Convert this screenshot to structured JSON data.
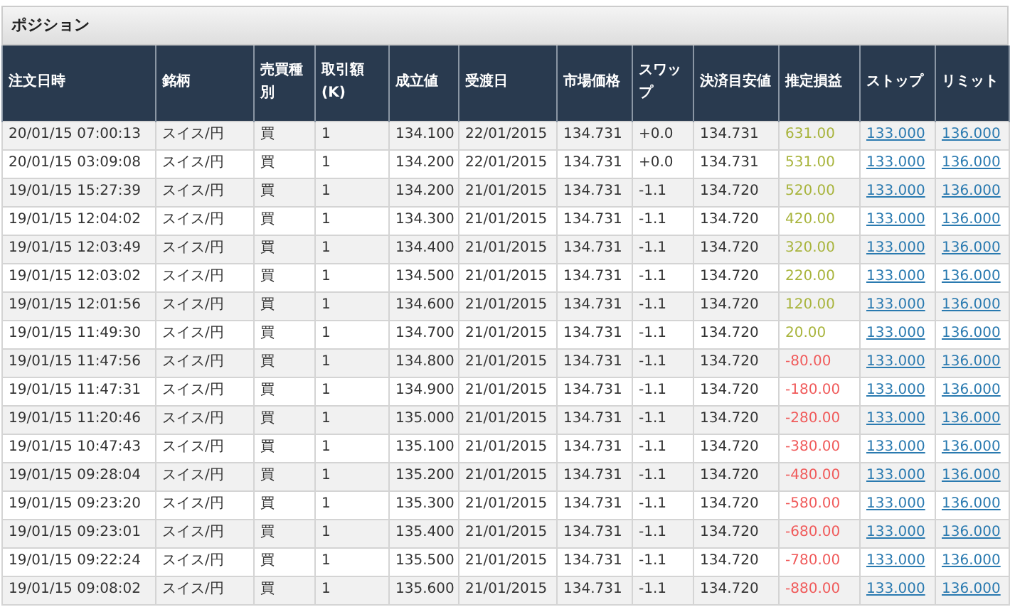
{
  "panel": {
    "title": "ポジション"
  },
  "table": {
    "columns": [
      {
        "label": "注文日時",
        "kind": "text"
      },
      {
        "label": "銘柄",
        "kind": "text"
      },
      {
        "label": "売買種別",
        "kind": "text"
      },
      {
        "label": "取引額(K)",
        "kind": "text"
      },
      {
        "label": "成立値",
        "kind": "number"
      },
      {
        "label": "受渡日",
        "kind": "text"
      },
      {
        "label": "市場価格",
        "kind": "text"
      },
      {
        "label": "スワップ",
        "kind": "text"
      },
      {
        "label": "決済目安値",
        "kind": "text"
      },
      {
        "label": "推定損益",
        "kind": "pnl"
      },
      {
        "label": "ストップ",
        "kind": "link"
      },
      {
        "label": "リミット",
        "kind": "link"
      }
    ],
    "rows": [
      {
        "color": "#a8b43c",
        "cells": [
          "20/01/15 07:00:13",
          "スイス/円",
          "買",
          "1",
          "134.100",
          "22/01/2015",
          "134.731",
          "+0.0",
          "134.731",
          "631.00",
          "133.000",
          "136.000"
        ]
      },
      {
        "color": "#a8b43c",
        "cells": [
          "20/01/15 03:09:08",
          "スイス/円",
          "買",
          "1",
          "134.200",
          "22/01/2015",
          "134.731",
          "+0.0",
          "134.731",
          "531.00",
          "133.000",
          "136.000"
        ]
      },
      {
        "color": "#a8b43c",
        "cells": [
          "19/01/15 15:27:39",
          "スイス/円",
          "買",
          "1",
          "134.200",
          "21/01/2015",
          "134.731",
          "-1.1",
          "134.720",
          "520.00",
          "133.000",
          "136.000"
        ]
      },
      {
        "color": "#a8b43c",
        "cells": [
          "19/01/15 12:04:02",
          "スイス/円",
          "買",
          "1",
          "134.300",
          "21/01/2015",
          "134.731",
          "-1.1",
          "134.720",
          "420.00",
          "133.000",
          "136.000"
        ]
      },
      {
        "color": "#a8b43c",
        "cells": [
          "19/01/15 12:03:49",
          "スイス/円",
          "買",
          "1",
          "134.400",
          "21/01/2015",
          "134.731",
          "-1.1",
          "134.720",
          "320.00",
          "133.000",
          "136.000"
        ]
      },
      {
        "color": "#a8b43c",
        "cells": [
          "19/01/15 12:03:02",
          "スイス/円",
          "買",
          "1",
          "134.500",
          "21/01/2015",
          "134.731",
          "-1.1",
          "134.720",
          "220.00",
          "133.000",
          "136.000"
        ]
      },
      {
        "color": "#a8b43c",
        "cells": [
          "19/01/15 12:01:56",
          "スイス/円",
          "買",
          "1",
          "134.600",
          "21/01/2015",
          "134.731",
          "-1.1",
          "134.720",
          "120.00",
          "133.000",
          "136.000"
        ]
      },
      {
        "color": "#a8b43c",
        "cells": [
          "19/01/15 11:49:30",
          "スイス/円",
          "買",
          "1",
          "134.700",
          "21/01/2015",
          "134.731",
          "-1.1",
          "134.720",
          "20.00",
          "133.000",
          "136.000"
        ]
      },
      {
        "color": "#f05a5a",
        "cells": [
          "19/01/15 11:47:56",
          "スイス/円",
          "買",
          "1",
          "134.800",
          "21/01/2015",
          "134.731",
          "-1.1",
          "134.720",
          "-80.00",
          "133.000",
          "136.000"
        ]
      },
      {
        "color": "#f05a5a",
        "cells": [
          "19/01/15 11:47:31",
          "スイス/円",
          "買",
          "1",
          "134.900",
          "21/01/2015",
          "134.731",
          "-1.1",
          "134.720",
          "-180.00",
          "133.000",
          "136.000"
        ]
      },
      {
        "color": "#f05a5a",
        "cells": [
          "19/01/15 11:20:46",
          "スイス/円",
          "買",
          "1",
          "135.000",
          "21/01/2015",
          "134.731",
          "-1.1",
          "134.720",
          "-280.00",
          "133.000",
          "136.000"
        ]
      },
      {
        "color": "#f05a5a",
        "cells": [
          "19/01/15 10:47:43",
          "スイス/円",
          "買",
          "1",
          "135.100",
          "21/01/2015",
          "134.731",
          "-1.1",
          "134.720",
          "-380.00",
          "133.000",
          "136.000"
        ]
      },
      {
        "color": "#f05a5a",
        "cells": [
          "19/01/15 09:28:04",
          "スイス/円",
          "買",
          "1",
          "135.200",
          "21/01/2015",
          "134.731",
          "-1.1",
          "134.720",
          "-480.00",
          "133.000",
          "136.000"
        ]
      },
      {
        "color": "#f05a5a",
        "cells": [
          "19/01/15 09:23:20",
          "スイス/円",
          "買",
          "1",
          "135.300",
          "21/01/2015",
          "134.731",
          "-1.1",
          "134.720",
          "-580.00",
          "133.000",
          "136.000"
        ]
      },
      {
        "color": "#f05a5a",
        "cells": [
          "19/01/15 09:23:01",
          "スイス/円",
          "買",
          "1",
          "135.400",
          "21/01/2015",
          "134.731",
          "-1.1",
          "134.720",
          "-680.00",
          "133.000",
          "136.000"
        ]
      },
      {
        "color": "#f05a5a",
        "cells": [
          "19/01/15 09:22:24",
          "スイス/円",
          "買",
          "1",
          "135.500",
          "21/01/2015",
          "134.731",
          "-1.1",
          "134.720",
          "-780.00",
          "133.000",
          "136.000"
        ]
      },
      {
        "color": "#f05a5a",
        "cells": [
          "19/01/15 09:08:02",
          "スイス/円",
          "買",
          "1",
          "135.600",
          "21/01/2015",
          "134.731",
          "-1.1",
          "134.720",
          "-880.00",
          "133.000",
          "136.000"
        ]
      }
    ]
  }
}
